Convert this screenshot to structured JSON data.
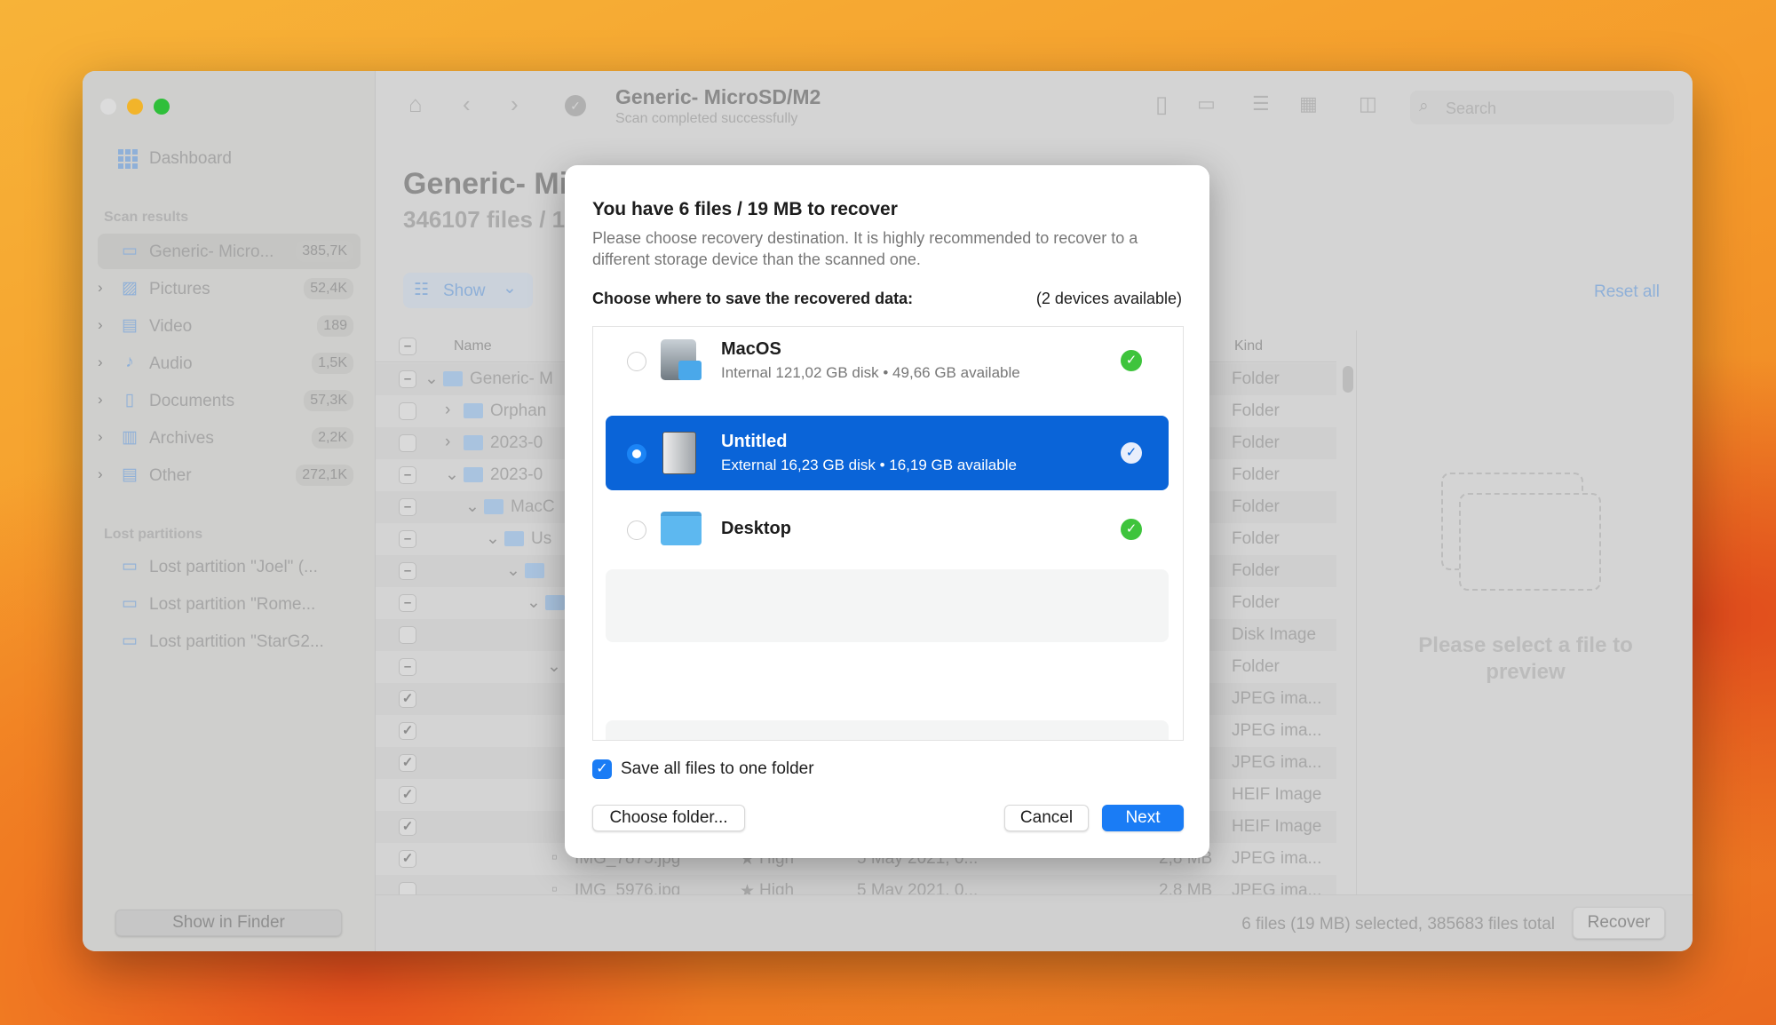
{
  "window": {
    "title": "Generic- MicroSD/M2",
    "subtitle": "Scan completed successfully",
    "search_placeholder": "Search"
  },
  "sidebar": {
    "dashboard": "Dashboard",
    "scan_results_label": "Scan results",
    "scan_items": [
      {
        "label": "Generic- Micro...",
        "count": "385,7K",
        "icon": "drive-icon"
      },
      {
        "label": "Pictures",
        "count": "52,4K",
        "icon": "picture-icon"
      },
      {
        "label": "Video",
        "count": "189",
        "icon": "film-icon"
      },
      {
        "label": "Audio",
        "count": "1,5K",
        "icon": "music-note-icon"
      },
      {
        "label": "Documents",
        "count": "57,3K",
        "icon": "document-icon"
      },
      {
        "label": "Archives",
        "count": "2,2K",
        "icon": "archive-icon"
      },
      {
        "label": "Other",
        "count": "272,1K",
        "icon": "file-icon"
      }
    ],
    "lost_label": "Lost partitions",
    "lost_items": [
      {
        "label": "Lost partition \"Joel\" (..."
      },
      {
        "label": "Lost partition \"Rome..."
      },
      {
        "label": "Lost partition \"StarG2..."
      }
    ],
    "show_in_finder": "Show in Finder"
  },
  "main": {
    "heading": "Generic- Mi",
    "subheading": "346107 files / 1",
    "show_label": "Show",
    "reset_all": "Reset all",
    "columns": {
      "name": "Name",
      "kind": "Kind"
    },
    "rows": [
      {
        "check": "mixed",
        "name": "Generic- M",
        "kind": "Folder"
      },
      {
        "check": "none",
        "name": "Orphan",
        "kind": "Folder"
      },
      {
        "check": "none",
        "name": "2023-0",
        "kind": "Folder"
      },
      {
        "check": "mixed",
        "name": "2023-0",
        "kind": "Folder"
      },
      {
        "check": "mixed",
        "name": "MacC",
        "kind": "Folder"
      },
      {
        "check": "mixed",
        "name": "Us",
        "kind": "Folder"
      },
      {
        "check": "mixed",
        "name": "",
        "kind": "Folder"
      },
      {
        "check": "mixed",
        "name": "",
        "kind": "Folder"
      },
      {
        "check": "none",
        "name": "",
        "kind": "Disk Image"
      },
      {
        "check": "mixed",
        "name": "",
        "kind": "Folder"
      },
      {
        "check": "checked",
        "name": "",
        "kind": "JPEG ima..."
      },
      {
        "check": "checked",
        "name": "",
        "kind": "JPEG ima..."
      },
      {
        "check": "checked",
        "name": "",
        "kind": "JPEG ima..."
      },
      {
        "check": "checked",
        "name": "",
        "kind": "HEIF Image"
      },
      {
        "check": "checked",
        "name": "",
        "kind": "HEIF Image"
      },
      {
        "check": "checked",
        "name": "IMG_7875.jpg",
        "priority": "High",
        "date": "5 May 2021, 0...",
        "size": "2,8 MB",
        "kind": "JPEG ima..."
      },
      {
        "check": "none",
        "name": "IMG_5976.jpg",
        "priority": "High",
        "date": "5 May 2021, 0...",
        "size": "2,8 MB",
        "kind": "JPEG ima..."
      }
    ],
    "preview_text": "Please select a file to preview",
    "status": "6 files (19 MB) selected, 385683 files total",
    "recover": "Recover"
  },
  "dialog": {
    "title": "You have 6 files / 19 MB to recover",
    "description": "Please choose recovery destination. It is highly recommended to recover to a different storage device than the scanned one.",
    "choose_label": "Choose where to save the recovered data:",
    "devices_count": "(2 devices available)",
    "devices": [
      {
        "name": "MacOS",
        "detail": "Internal 121,02 GB disk • 49,66 GB available",
        "selected": false
      },
      {
        "name": "Untitled",
        "detail": "External 16,23 GB disk • 16,19 GB available",
        "selected": true
      },
      {
        "name": "Desktop",
        "detail": "",
        "selected": false
      }
    ],
    "save_one_folder": "Save all files to one folder",
    "save_one_folder_checked": true,
    "choose_folder": "Choose folder...",
    "cancel": "Cancel",
    "next": "Next"
  },
  "colors": {
    "accent": "#0a64d8",
    "next_button": "#1a7cf5",
    "ok_green": "#3ec43c"
  }
}
